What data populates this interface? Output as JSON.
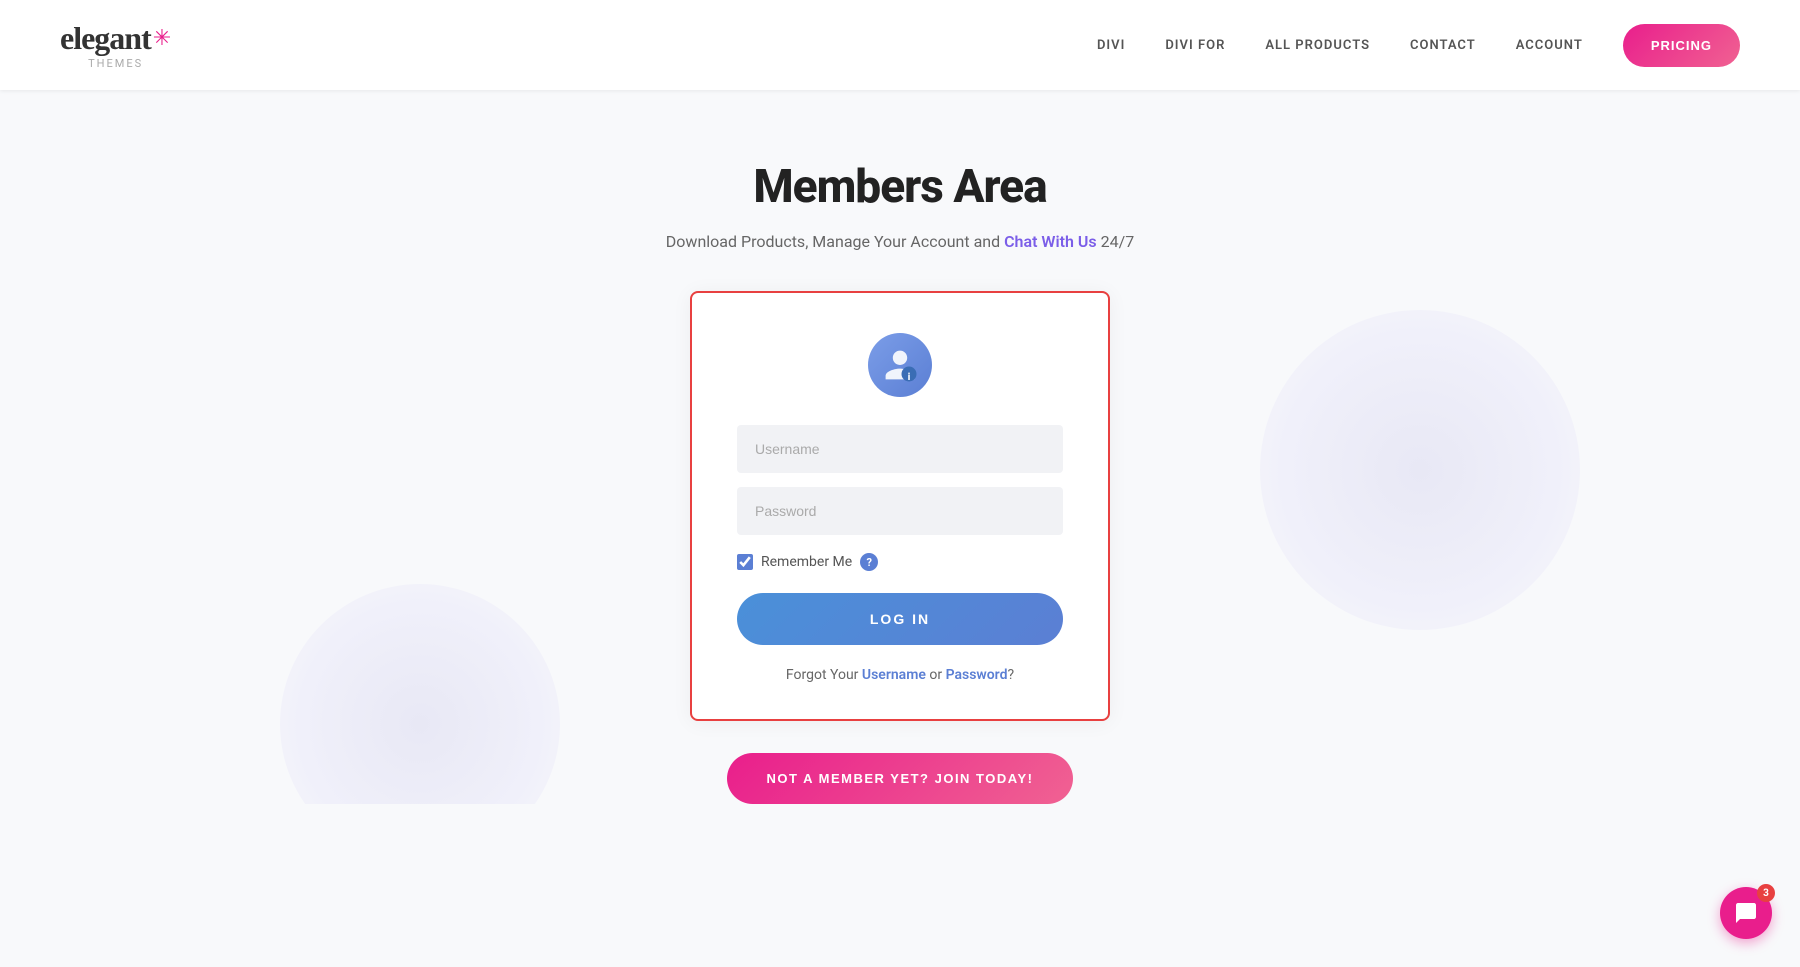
{
  "header": {
    "logo_text": "elegant",
    "logo_sub": "themes",
    "nav": [
      {
        "label": "DIVI",
        "id": "nav-divi"
      },
      {
        "label": "DIVI FOR",
        "id": "nav-divi-for"
      },
      {
        "label": "ALL PRODUCTS",
        "id": "nav-all-products"
      },
      {
        "label": "CONTACT",
        "id": "nav-contact"
      },
      {
        "label": "ACCOUNT",
        "id": "nav-account"
      }
    ],
    "pricing_label": "PRICING"
  },
  "main": {
    "title": "Members Area",
    "subtitle_pre": "Download Products, Manage Your Account and ",
    "subtitle_link": "Chat With Us",
    "subtitle_post": " 24/7"
  },
  "login": {
    "username_placeholder": "Username",
    "password_placeholder": "Password",
    "remember_label": "Remember Me",
    "login_button": "LOG IN",
    "forgot_pre": "Forgot Your ",
    "forgot_username": "Username",
    "forgot_mid": " or ",
    "forgot_password": "Password",
    "forgot_post": "?"
  },
  "join": {
    "label": "NOT A MEMBER YET? JOIN TODAY!"
  },
  "chat": {
    "badge": "3"
  }
}
